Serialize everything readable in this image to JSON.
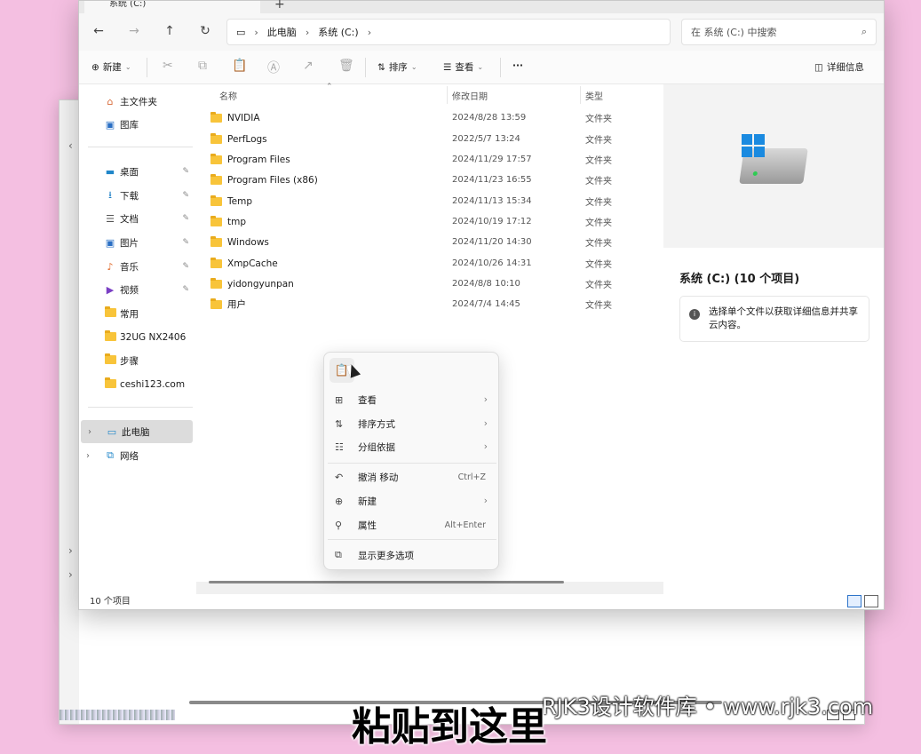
{
  "window": {
    "tab_title": "系统 (C:)",
    "tab_new": "+"
  },
  "nav": {
    "back": "←",
    "forward": "→",
    "up": "↑",
    "refresh": "↻"
  },
  "address": {
    "root_icon": "monitor-icon",
    "crumbs": [
      "此电脑",
      "系统 (C:)"
    ],
    "separator": "›"
  },
  "search": {
    "placeholder": "在 系统 (C:) 中搜索",
    "icon": "⌕"
  },
  "commands": {
    "new_label": "新建",
    "sort_label": "排序",
    "view_label": "查看",
    "more_label": "···",
    "details_label": "详细信息"
  },
  "sidebar": {
    "items": [
      {
        "label": "主文件夹",
        "icon": "home-icon",
        "glyph": "⌂"
      },
      {
        "label": "图库",
        "icon": "gallery-icon",
        "glyph": "▣"
      },
      {
        "label": "桌面",
        "icon": "desktop-icon",
        "glyph": "▬",
        "pinned": true
      },
      {
        "label": "下载",
        "icon": "download-icon",
        "glyph": "⭳",
        "pinned": true
      },
      {
        "label": "文档",
        "icon": "document-icon",
        "glyph": "☰",
        "pinned": true
      },
      {
        "label": "图片",
        "icon": "pictures-icon",
        "glyph": "▣",
        "pinned": true
      },
      {
        "label": "音乐",
        "icon": "music-icon",
        "glyph": "♪",
        "pinned": true
      },
      {
        "label": "视频",
        "icon": "video-icon",
        "glyph": "▶",
        "pinned": true
      },
      {
        "label": "常用",
        "icon": "folder-icon"
      },
      {
        "label": "32UG NX2406",
        "icon": "folder-icon"
      },
      {
        "label": "步骤",
        "icon": "folder-icon"
      },
      {
        "label": "ceshi123.com",
        "icon": "folder-icon"
      },
      {
        "label": "此电脑",
        "icon": "this-pc-icon",
        "glyph": "▭"
      },
      {
        "label": "网络",
        "icon": "network-icon",
        "glyph": "⧉"
      }
    ],
    "pin_glyph": "✎"
  },
  "list": {
    "headers": {
      "name": "名称",
      "date": "修改日期",
      "type": "类型"
    },
    "rows": [
      {
        "name": "NVIDIA",
        "date": "2024/8/28 13:59",
        "type": "文件夹"
      },
      {
        "name": "PerfLogs",
        "date": "2022/5/7 13:24",
        "type": "文件夹"
      },
      {
        "name": "Program Files",
        "date": "2024/11/29 17:57",
        "type": "文件夹"
      },
      {
        "name": "Program Files (x86)",
        "date": "2024/11/23 16:55",
        "type": "文件夹"
      },
      {
        "name": "Temp",
        "date": "2024/11/13 15:34",
        "type": "文件夹"
      },
      {
        "name": "tmp",
        "date": "2024/10/19 17:12",
        "type": "文件夹"
      },
      {
        "name": "Windows",
        "date": "2024/11/20 14:30",
        "type": "文件夹"
      },
      {
        "name": "XmpCache",
        "date": "2024/10/26 14:31",
        "type": "文件夹"
      },
      {
        "name": "yidongyunpan",
        "date": "2024/8/8 10:10",
        "type": "文件夹"
      },
      {
        "name": "用户",
        "date": "2024/7/4 14:45",
        "type": "文件夹"
      }
    ]
  },
  "details": {
    "title": "系统 (C:) (10 个项目)",
    "info": "选择单个文件以获取详细信息并共享云内容。"
  },
  "status": {
    "count": "10 个项目"
  },
  "context_menu": {
    "items": [
      {
        "label": "查看",
        "icon": "grid-icon",
        "glyph": "⊞",
        "submenu": true,
        "shortcut": ""
      },
      {
        "label": "排序方式",
        "icon": "sort-icon",
        "glyph": "⇅",
        "submenu": true,
        "shortcut": ""
      },
      {
        "label": "分组依据",
        "icon": "group-icon",
        "glyph": "☷",
        "submenu": true,
        "shortcut": ""
      },
      {
        "label": "撤消 移动",
        "icon": "undo-icon",
        "glyph": "↶",
        "submenu": false,
        "shortcut": "Ctrl+Z"
      },
      {
        "label": "新建",
        "icon": "new-icon",
        "glyph": "⊕",
        "submenu": true,
        "shortcut": ""
      },
      {
        "label": "属性",
        "icon": "properties-icon",
        "glyph": "🔧",
        "submenu": false,
        "shortcut": "Alt+Enter"
      },
      {
        "label": "显示更多选项",
        "icon": "more-options-icon",
        "glyph": "⧉",
        "submenu": false,
        "shortcut": ""
      }
    ],
    "arrow": "›"
  },
  "overlay": {
    "subtitle": "粘贴到这里",
    "watermark": "RJK3设计软件库 • www.rjk3.com"
  },
  "colors": {
    "background": "#f4bfe1",
    "folder": "#f8c43a",
    "accent": "#1a8ae0"
  }
}
